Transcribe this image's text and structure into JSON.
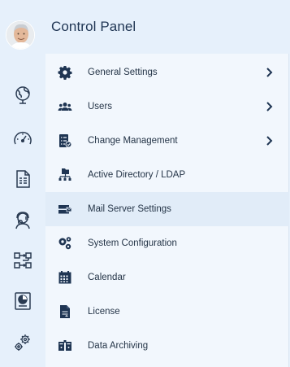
{
  "header": {
    "title": "Control Panel"
  },
  "rail": {
    "items": [
      {
        "icon": "globe-icon"
      },
      {
        "icon": "speedometer-icon"
      },
      {
        "icon": "document-icon"
      },
      {
        "icon": "support-agent-icon"
      },
      {
        "icon": "workflow-icon"
      },
      {
        "icon": "report-chart-icon"
      },
      {
        "icon": "settings-gears-icon"
      }
    ]
  },
  "menu": {
    "items": [
      {
        "label": "General Settings",
        "icon": "gear-icon",
        "has_submenu": true
      },
      {
        "label": "Users",
        "icon": "users-icon",
        "has_submenu": true
      },
      {
        "label": "Change Management",
        "icon": "checklist-icon",
        "has_submenu": true
      },
      {
        "label": "Active Directory / LDAP",
        "icon": "directory-icon",
        "has_submenu": false
      },
      {
        "label": "Mail Server Settings",
        "icon": "mail-server-icon",
        "has_submenu": false,
        "selected": true
      },
      {
        "label": "System Configuration",
        "icon": "system-config-icon",
        "has_submenu": false
      },
      {
        "label": "Calendar",
        "icon": "calendar-icon",
        "has_submenu": false
      },
      {
        "label": "License",
        "icon": "license-icon",
        "has_submenu": false
      },
      {
        "label": "Data Archiving",
        "icon": "archive-icon",
        "has_submenu": false
      }
    ]
  },
  "colors": {
    "accent": "#1f3553",
    "selected_row": "#e1ecf8",
    "panel": "#f2f7fd"
  }
}
